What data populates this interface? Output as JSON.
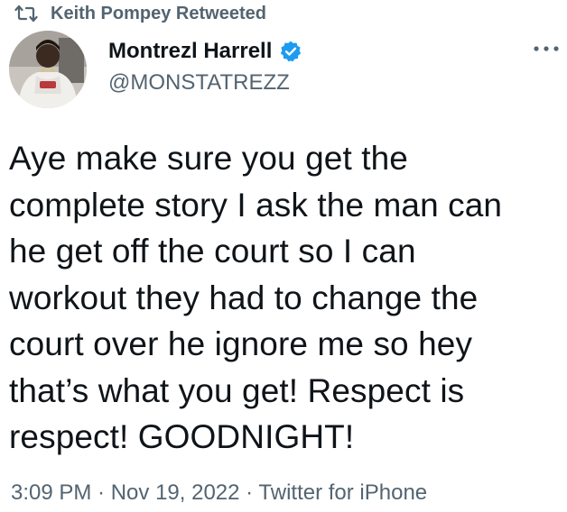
{
  "retweet": {
    "icon": "retweet-icon",
    "label": "Keith Pompey Retweeted"
  },
  "author": {
    "display_name": "Montrezl Harrell",
    "handle": "@MONSTATREZZ",
    "verified_icon": "verified-badge-icon",
    "verified_color": "#1d9bf0",
    "avatar_icon": "avatar"
  },
  "menu": {
    "icon": "more-icon"
  },
  "tweet": {
    "lines": [
      "Aye make sure you get the",
      "complete story I ask the man can",
      "he get off the court so I can",
      "workout they had to change the",
      "court over he ignore me so hey",
      "that’s what you get! Respect is",
      "respect! GOODNIGHT!"
    ]
  },
  "meta": {
    "time": "3:09 PM",
    "separator": " · ",
    "date": "Nov 19, 2022",
    "source": "Twitter for iPhone"
  },
  "colors": {
    "text_primary": "#0f1419",
    "text_secondary": "#536471",
    "accent": "#1d9bf0"
  }
}
